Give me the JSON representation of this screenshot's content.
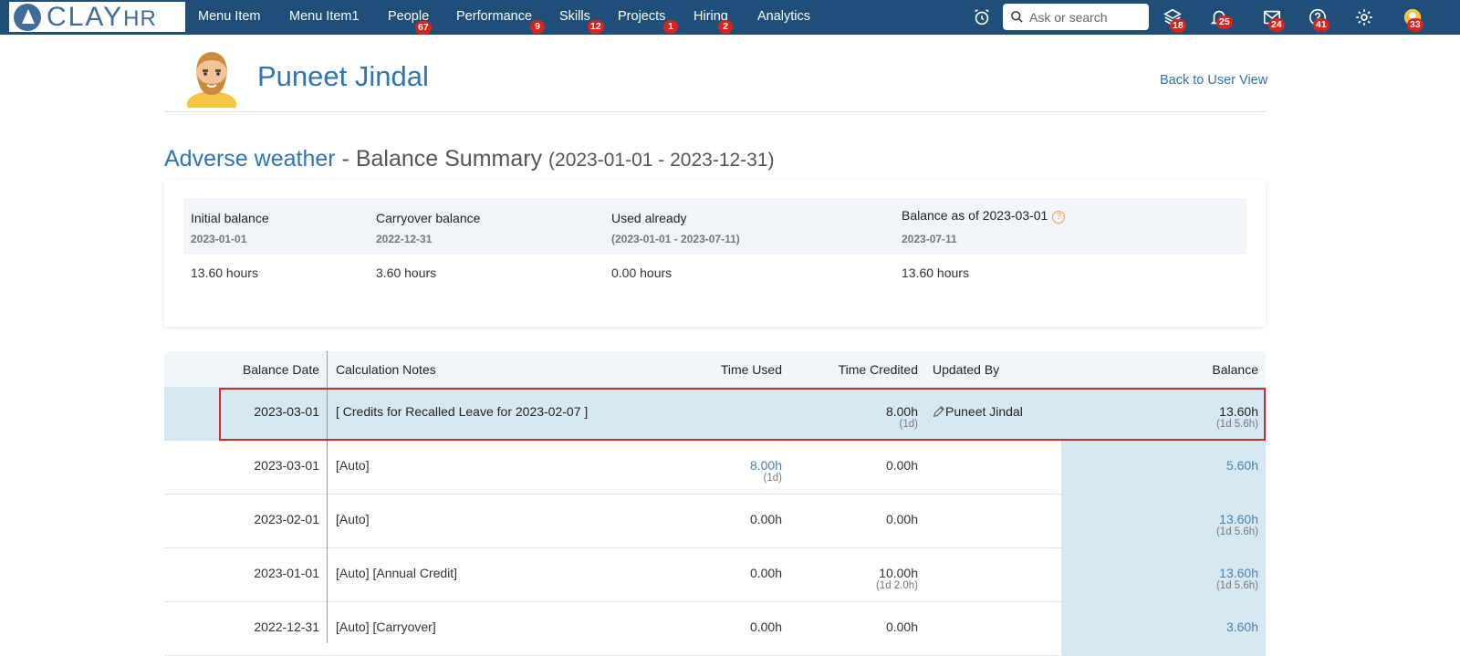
{
  "app": {
    "logo_main": "CLAY",
    "logo_suffix": "HR"
  },
  "nav": {
    "items": [
      {
        "label": "Menu Item",
        "badge": ""
      },
      {
        "label": "Menu Item1",
        "badge": ""
      },
      {
        "label": "People",
        "badge": "67"
      },
      {
        "label": "Performance",
        "badge": "9"
      },
      {
        "label": "Skills",
        "badge": "12"
      },
      {
        "label": "Projects",
        "badge": "1"
      },
      {
        "label": "Hiring",
        "badge": "2"
      },
      {
        "label": "Analytics",
        "badge": ""
      }
    ],
    "search_placeholder": "Ask or search",
    "icons": [
      {
        "name": "alarm-clock-icon",
        "badge": ""
      },
      {
        "name": "stack-icon",
        "badge": "18"
      },
      {
        "name": "bell-icon",
        "badge": "25"
      },
      {
        "name": "mail-icon",
        "badge": "24"
      },
      {
        "name": "help-icon",
        "badge": "41"
      },
      {
        "name": "gear-icon",
        "badge": ""
      },
      {
        "name": "user-avatar-icon",
        "badge": "33"
      }
    ]
  },
  "header": {
    "user_name": "Puneet Jindal",
    "back_link": "Back to User View"
  },
  "page_title": {
    "leave_type": "Adverse weather",
    "separator": " - Balance Summary ",
    "range": "(2023-01-01 - 2023-12-31)"
  },
  "summary": {
    "initial": {
      "label": "Initial balance",
      "sub": "2023-01-01",
      "value": "13.60 hours"
    },
    "carryover": {
      "label": "Carryover balance",
      "sub": "2022-12-31",
      "value": "3.60 hours"
    },
    "used": {
      "label": "Used already",
      "sub": "(2023-01-01 - 2023-07-11)",
      "value": "0.00 hours"
    },
    "balance": {
      "label": "Balance as of 2023-03-01",
      "help": "?",
      "sub": "2023-07-11",
      "value": "13.60 hours"
    }
  },
  "table": {
    "headers": {
      "date": "Balance Date",
      "notes": "Calculation Notes",
      "used": "Time Used",
      "credited": "Time Credited",
      "updated_by": "Updated By",
      "balance": "Balance"
    },
    "rows": [
      {
        "date": "2023-03-01",
        "notes": "[ Credits for Recalled Leave for 2023-02-07 ]",
        "used": "",
        "used_sub": "",
        "credited": "8.00h",
        "credited_sub": "(1d)",
        "updated_by": "Puneet Jindal",
        "balance": "13.60h",
        "balance_sub": "(1d 5.6h)"
      },
      {
        "date": "2023-03-01",
        "notes": "[Auto]",
        "used": "8.00h",
        "used_sub": "(1d)",
        "credited": "0.00h",
        "credited_sub": "",
        "updated_by": "",
        "balance": "5.60h",
        "balance_sub": ""
      },
      {
        "date": "2023-02-01",
        "notes": "[Auto]",
        "used": "0.00h",
        "used_sub": "",
        "credited": "0.00h",
        "credited_sub": "",
        "updated_by": "",
        "balance": "13.60h",
        "balance_sub": "(1d 5.6h)"
      },
      {
        "date": "2023-01-01",
        "notes": "[Auto] [Annual Credit]",
        "used": "0.00h",
        "used_sub": "",
        "credited": "10.00h",
        "credited_sub": "(1d 2.0h)",
        "updated_by": "",
        "balance": "13.60h",
        "balance_sub": "(1d 5.6h)"
      },
      {
        "date": "2022-12-31",
        "notes": "[Auto] [Carryover]",
        "used": "0.00h",
        "used_sub": "",
        "credited": "0.00h",
        "credited_sub": "",
        "updated_by": "",
        "balance": "3.60h",
        "balance_sub": ""
      }
    ]
  },
  "colors": {
    "nav_bg": "#1f4e79",
    "accent": "#2f74b5",
    "badge": "#d9241c",
    "highlight": "#d6e9f3",
    "selection": "#e0242b"
  }
}
